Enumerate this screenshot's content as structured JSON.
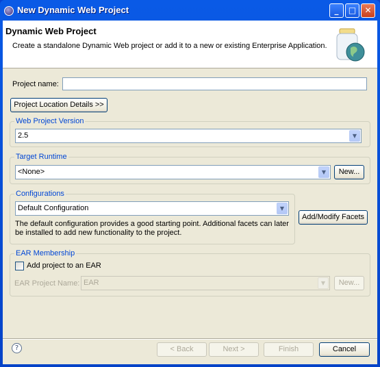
{
  "window": {
    "title": "New Dynamic Web Project",
    "controls": [
      "minimize",
      "maximize",
      "close"
    ]
  },
  "header": {
    "title": "Dynamic Web Project",
    "description": "Create a standalone Dynamic Web project or add it to a new or existing Enterprise Application.",
    "icon": "jar-globe-icon"
  },
  "project_name": {
    "label": "Project name:",
    "value": ""
  },
  "location_button": "Project Location Details >>",
  "web_version": {
    "label": "Web Project Version",
    "selected": "2.5"
  },
  "target_runtime": {
    "label": "Target Runtime",
    "selected": "<None>",
    "new_button": "New..."
  },
  "configurations": {
    "label": "Configurations",
    "selected": "Default Configuration",
    "description_line1": "The default configuration provides a good starting point. Additional facets can later",
    "description_line2": "be installed to add new functionality to the project.",
    "facets_button": "Add/Modify Facets"
  },
  "ear": {
    "label": "EAR Membership",
    "checkbox_label": "Add project to an EAR",
    "checked": false,
    "name_label": "EAR Project Name:",
    "selected": "EAR",
    "new_button": "New..."
  },
  "footer": {
    "back": "< Back",
    "next": "Next >",
    "finish": "Finish",
    "cancel": "Cancel",
    "help_icon": "?"
  },
  "colors": {
    "titlebar": "#0a5ae6",
    "dialog_bg": "#ece9d8",
    "group_label": "#0046d5"
  }
}
